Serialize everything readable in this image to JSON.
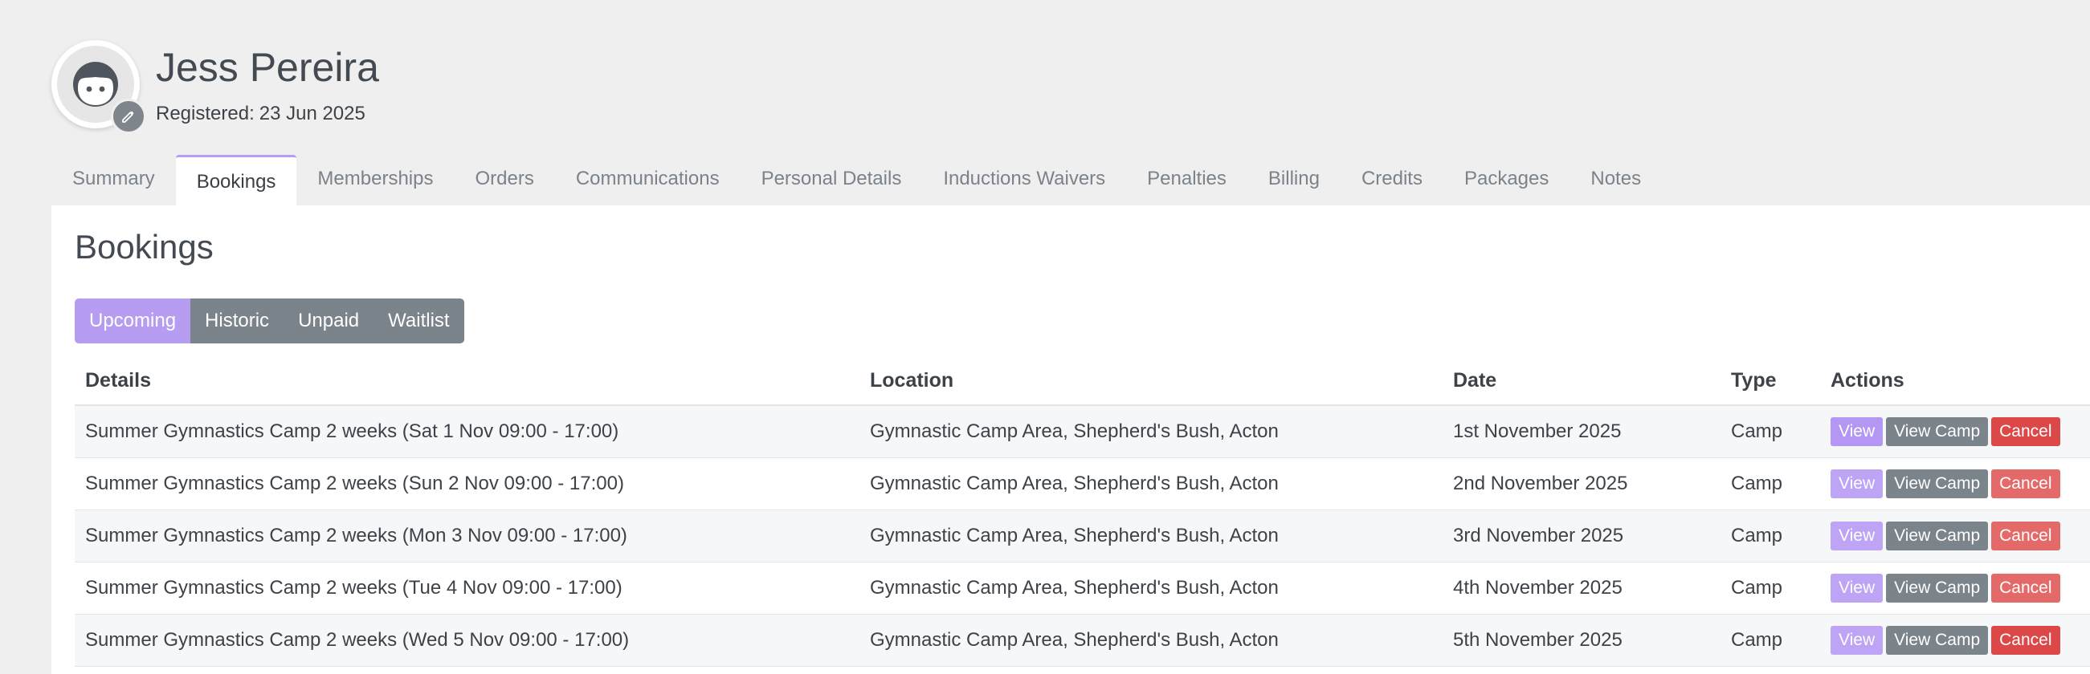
{
  "profile": {
    "name": "Jess Pereira",
    "registered_label": "Registered:",
    "registered_date": "23 Jun 2025",
    "avatar_icon": "user-face-icon",
    "edit_icon": "pencil-icon"
  },
  "tabs": [
    {
      "label": "Summary"
    },
    {
      "label": "Bookings",
      "active": true
    },
    {
      "label": "Memberships"
    },
    {
      "label": "Orders"
    },
    {
      "label": "Communications"
    },
    {
      "label": "Personal Details"
    },
    {
      "label": "Inductions Waivers"
    },
    {
      "label": "Penalties"
    },
    {
      "label": "Billing"
    },
    {
      "label": "Credits"
    },
    {
      "label": "Packages"
    },
    {
      "label": "Notes"
    }
  ],
  "panel": {
    "title": "Bookings",
    "subtabs": [
      {
        "label": "Upcoming",
        "active": true
      },
      {
        "label": "Historic"
      },
      {
        "label": "Unpaid"
      },
      {
        "label": "Waitlist"
      }
    ]
  },
  "table": {
    "headers": {
      "details": "Details",
      "location": "Location",
      "date": "Date",
      "type": "Type",
      "actions": "Actions"
    },
    "action_labels": {
      "view": "View",
      "view_camp": "View Camp",
      "cancel": "Cancel"
    },
    "rows": [
      {
        "details": "Summer Gymnastics Camp 2 weeks (Sat 1 Nov 09:00 - 17:00)",
        "location": "Gymnastic Camp Area, Shepherd's Bush, Acton",
        "date": "1st November 2025",
        "type": "Camp"
      },
      {
        "details": "Summer Gymnastics Camp 2 weeks (Sun 2 Nov 09:00 - 17:00)",
        "location": "Gymnastic Camp Area, Shepherd's Bush, Acton",
        "date": "2nd November 2025",
        "type": "Camp"
      },
      {
        "details": "Summer Gymnastics Camp 2 weeks (Mon 3 Nov 09:00 - 17:00)",
        "location": "Gymnastic Camp Area, Shepherd's Bush, Acton",
        "date": "3rd November 2025",
        "type": "Camp"
      },
      {
        "details": "Summer Gymnastics Camp 2 weeks (Tue 4 Nov 09:00 - 17:00)",
        "location": "Gymnastic Camp Area, Shepherd's Bush, Acton",
        "date": "4th November 2025",
        "type": "Camp"
      },
      {
        "details": "Summer Gymnastics Camp 2 weeks (Wed 5 Nov 09:00 - 17:00)",
        "location": "Gymnastic Camp Area, Shepherd's Bush, Acton",
        "date": "5th November 2025",
        "type": "Camp"
      }
    ]
  },
  "colors": {
    "accent": "#b79df2",
    "secondary": "#7b838b",
    "danger": "#dc4847",
    "background": "#efefef"
  }
}
